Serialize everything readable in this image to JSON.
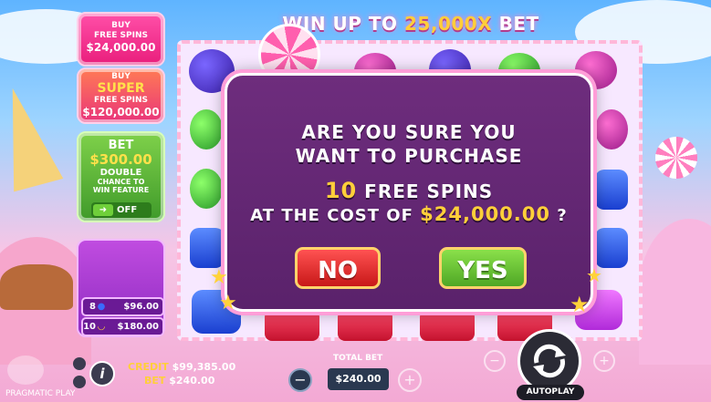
{
  "header": {
    "title_prefix": "WIN UP TO ",
    "title_highlight": "25,000X",
    "title_suffix": " BET"
  },
  "left_panel": {
    "buy_free_spins": {
      "line1": "BUY",
      "line2": "FREE SPINS",
      "price": "$24,000.00"
    },
    "buy_super_free_spins": {
      "line1": "BUY",
      "line2": "SUPER",
      "line3": "FREE SPINS",
      "price": "$120,000.00"
    },
    "bet_feature": {
      "label": "BET",
      "value": "$300.00",
      "line1": "DOUBLE",
      "line2": "CHANCE TO",
      "line3": "WIN FEATURE",
      "toggle_state": "OFF"
    },
    "multipliers": [
      {
        "count": "8",
        "symbol": "blue-candy-icon",
        "value": "$96.00"
      },
      {
        "count": "10",
        "symbol": "banana-icon",
        "value": "$180.00"
      }
    ]
  },
  "dialog": {
    "line1": "ARE YOU SURE YOU",
    "line2": "WANT TO PURCHASE",
    "spins_count": "10",
    "spins_label": " FREE SPINS",
    "cost_prefix": "AT THE COST OF ",
    "cost_value": "$24,000.00",
    "cost_suffix": " ?",
    "no_label": "NO",
    "yes_label": "YES"
  },
  "bottom_bar": {
    "credit_label": "CREDIT",
    "credit_value": "$99,385.00",
    "bet_label": "BET",
    "bet_value": "$240.00",
    "total_bet_label": "TOTAL BET",
    "total_bet_value": "$240.00",
    "minus": "−",
    "plus": "+",
    "autoplay_label": "AUTOPLAY",
    "info": "i",
    "brand": "PRAGMATIC PLAY"
  },
  "colors": {
    "accent_yellow": "#ffcf3a",
    "dialog_bg": "#6e2d7d",
    "no_red": "#d62222",
    "yes_green": "#6cc43a"
  }
}
